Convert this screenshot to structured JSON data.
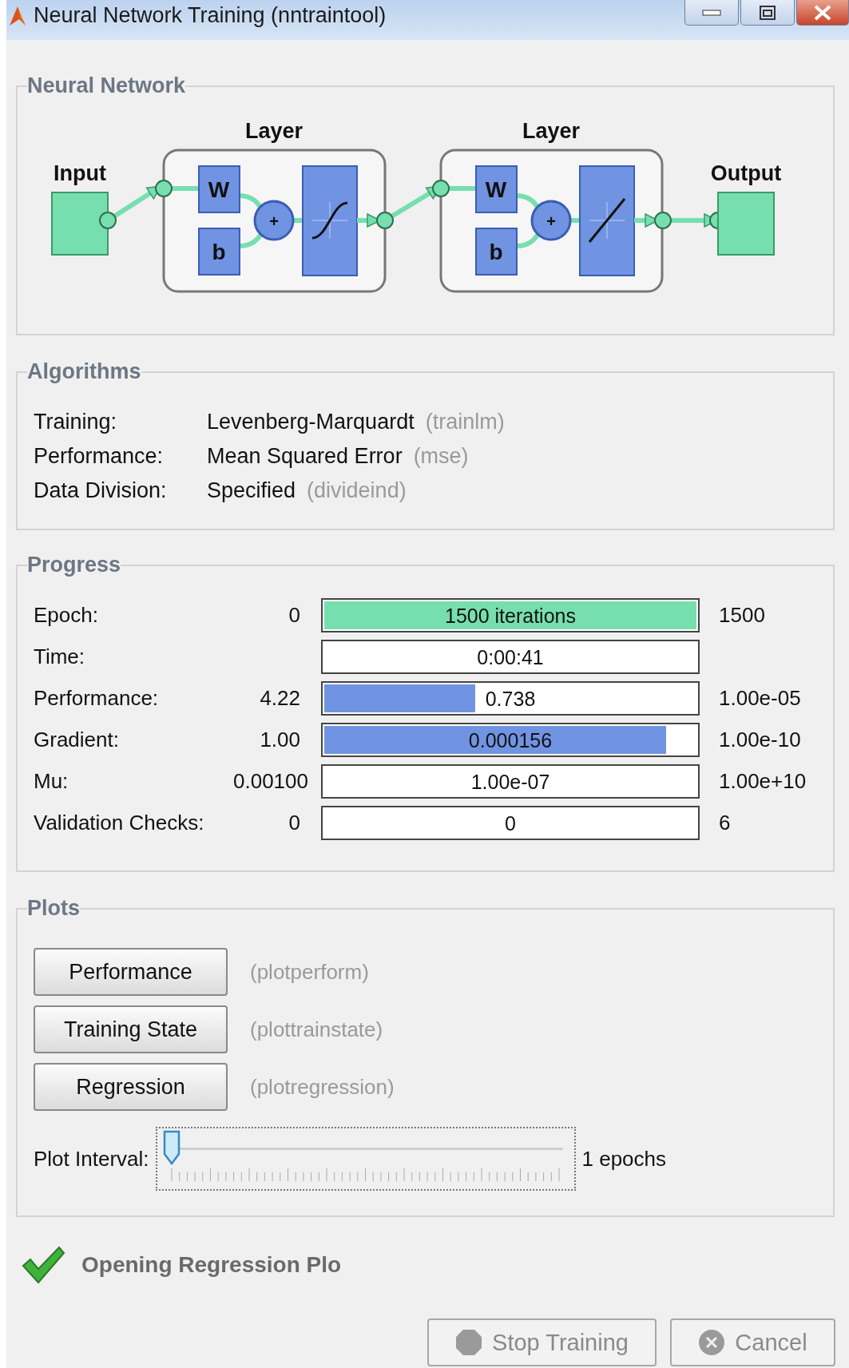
{
  "window": {
    "title": "Neural Network Training (nntraintool)",
    "controls": [
      {
        "kind": "minimize"
      },
      {
        "kind": "maximize"
      },
      {
        "kind": "close"
      }
    ]
  },
  "network": {
    "legend": "Neural Network",
    "input_label": "Input",
    "output_label": "Output",
    "layers": [
      {
        "label": "Layer",
        "weight": "W",
        "bias": "b",
        "sum": "+",
        "kind": "sigmoid"
      },
      {
        "label": "Layer",
        "weight": "W",
        "bias": "b",
        "sum": "+",
        "kind": "linear"
      }
    ]
  },
  "algorithms": {
    "legend": "Algorithms",
    "rows": [
      {
        "label": "Training:",
        "value": "Levenberg-Marquardt",
        "code": "(trainlm)"
      },
      {
        "label": "Performance:",
        "value": "Mean Squared Error",
        "code": "(mse)"
      },
      {
        "label": "Data Division:",
        "value": "Specified",
        "code": "(divideind)"
      }
    ]
  },
  "progress": {
    "legend": "Progress",
    "rows": [
      {
        "label": "Epoch:",
        "start": "0",
        "reading": "1500 iterations",
        "end": "1500",
        "level": 1,
        "kind": "epoch"
      },
      {
        "label": "Time:",
        "reading": "0:00:41",
        "level": 0,
        "kind": "plain"
      },
      {
        "label": "Performance:",
        "start": "4.22",
        "reading": "0.738",
        "end": "1.00e-05",
        "level": 0.41,
        "kind": "value"
      },
      {
        "label": "Gradient:",
        "start": "1.00",
        "reading": "0.000156",
        "end": "1.00e-10",
        "level": 0.92,
        "kind": "value"
      },
      {
        "label": "Mu:",
        "start": "0.00100",
        "reading": "1.00e-07",
        "end": "1.00e+10",
        "level": 0,
        "kind": "value"
      },
      {
        "label": "Validation Checks:",
        "start": "0",
        "reading": "0",
        "end": "6",
        "level": 0,
        "kind": "value"
      }
    ]
  },
  "plots": {
    "legend": "Plots",
    "buttons": [
      {
        "label": "Performance",
        "function": "(plotperform)"
      },
      {
        "label": "Training State",
        "function": "(plottrainstate)"
      },
      {
        "label": "Regression",
        "function": "(plotregression)"
      }
    ],
    "interval": {
      "label": "Plot Interval:",
      "level": 0,
      "reading": "1 epochs"
    }
  },
  "status": {
    "text": "Opening Regression Plo"
  },
  "buttons": [
    {
      "label": "Stop Training",
      "kind": "stop",
      "disabled": true
    },
    {
      "label": "Cancel",
      "kind": "cancel",
      "disabled": true
    }
  ]
}
